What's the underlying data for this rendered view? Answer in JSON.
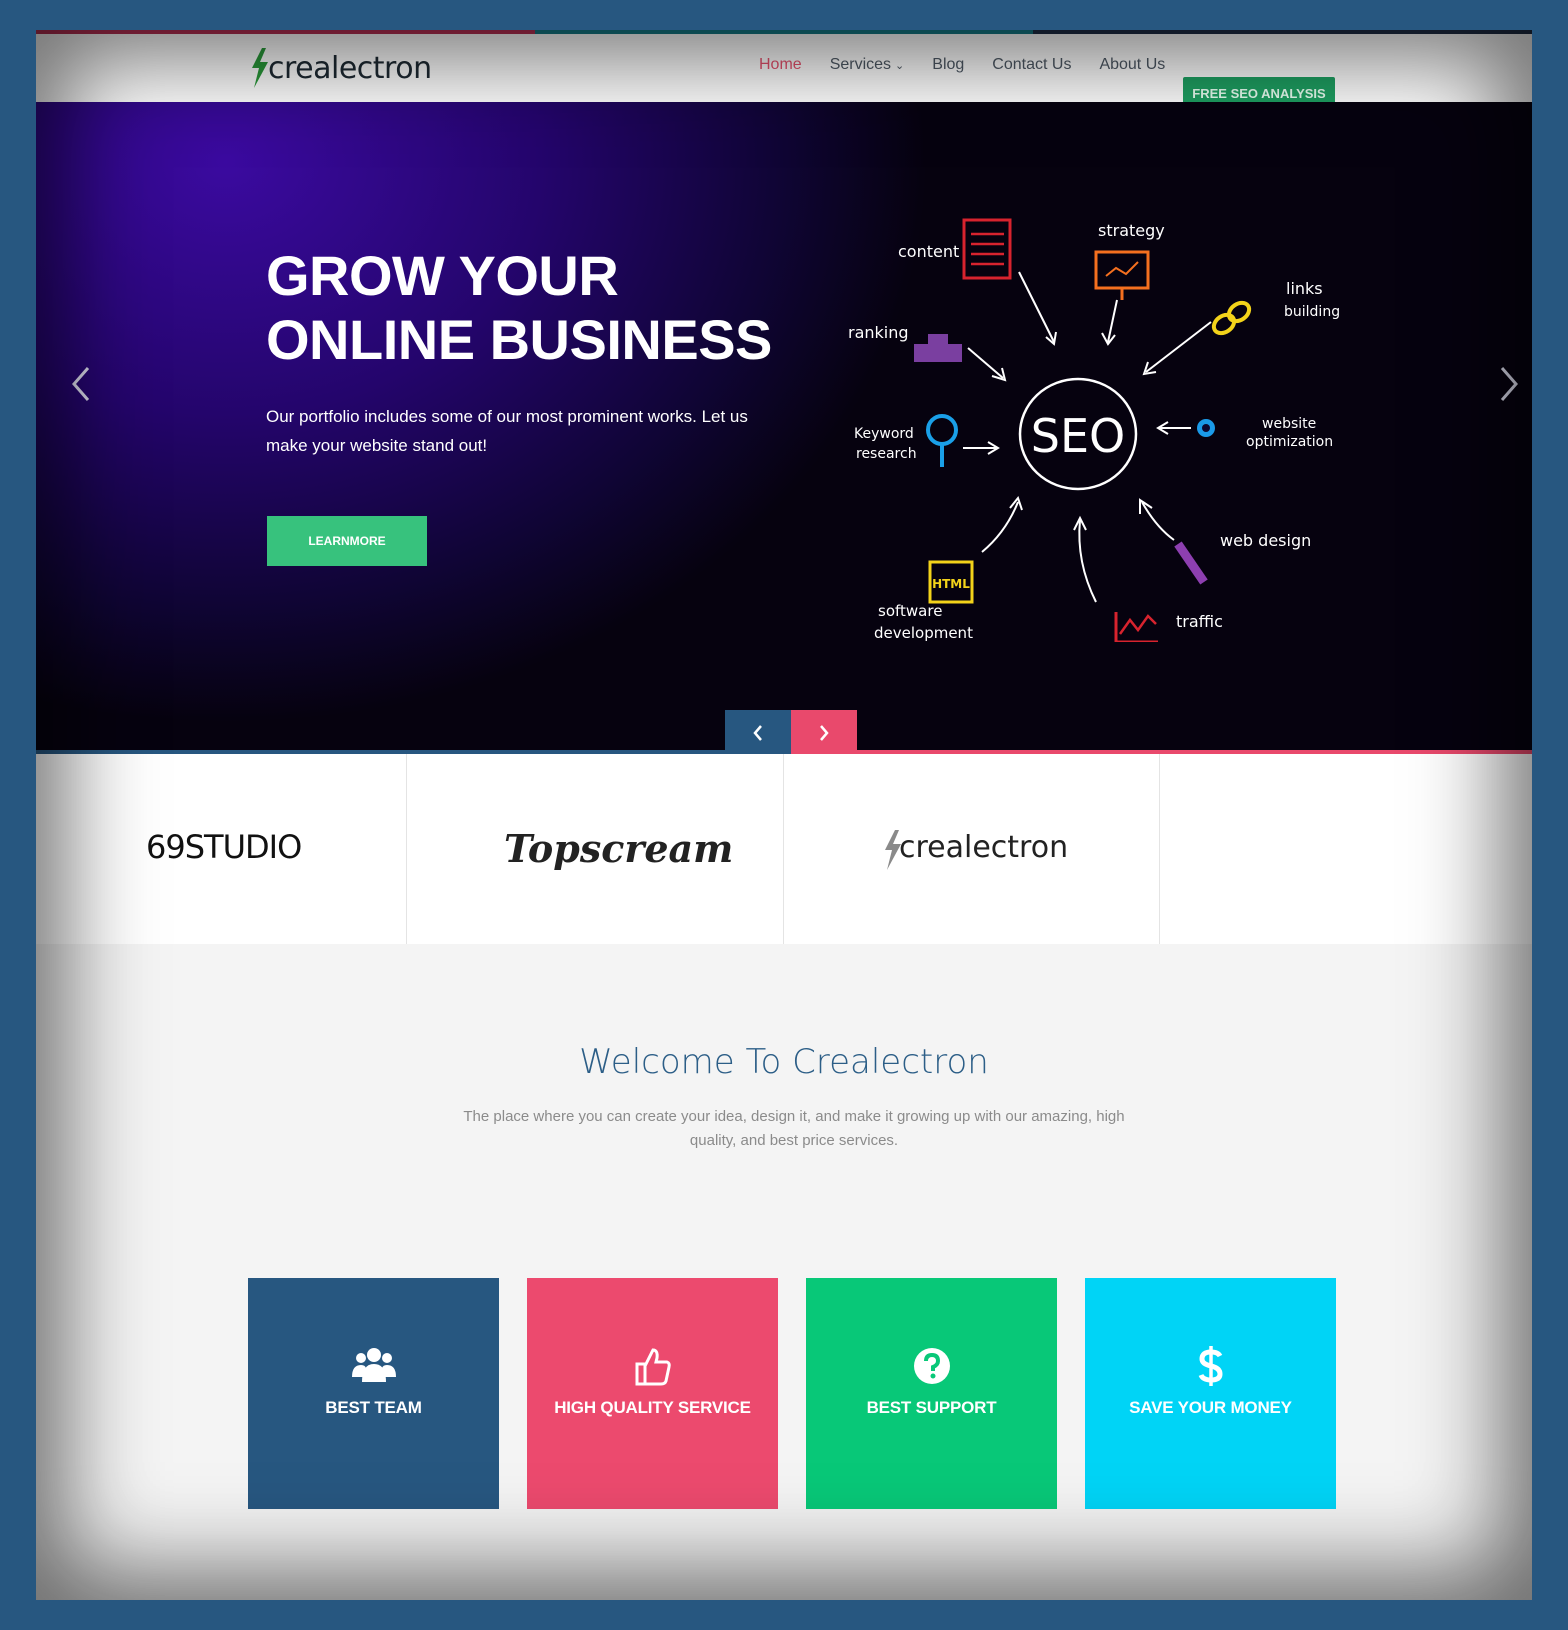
{
  "brand": {
    "name": "crealectron",
    "bolt_color": "#2a9a3a"
  },
  "top_strip_colors": [
    "#b63054",
    "#147a86",
    "#1f2d45"
  ],
  "nav": {
    "items": [
      {
        "label": "Home",
        "active": true
      },
      {
        "label": "Services",
        "active": false,
        "has_dropdown": true,
        "icon": "chevron-down-icon"
      },
      {
        "label": "Blog",
        "active": false
      },
      {
        "label": "Contact Us",
        "active": false
      },
      {
        "label": "About Us",
        "active": false
      }
    ],
    "cta_label": "FREE SEO ANALYSIS"
  },
  "hero": {
    "title": "GROW YOUR\nONLINE BUSINESS",
    "text": "Our portfolio includes some of our most prominent works. Let us make your website stand out!",
    "button_label": "LEARNMORE",
    "prev_icon": "chevron-left-icon",
    "next_icon": "chevron-right-icon",
    "illustration": {
      "center": "SEO",
      "labels": {
        "content": "content",
        "strategy": "strategy",
        "links_1": "links",
        "links_2": "building",
        "ranking": "ranking",
        "keyword_1": "Keyword",
        "keyword_2": "research",
        "website_1": "website",
        "website_2": "optimization",
        "html": "HTML",
        "software_1": "software",
        "software_2": "development",
        "traffic": "traffic",
        "web_design": "web design"
      }
    }
  },
  "pager": {
    "prev_color": "#275780",
    "next_color": "#e9496c"
  },
  "clients": [
    {
      "name": "69STUDIO"
    },
    {
      "name": "Topscream"
    },
    {
      "name": "crealectron"
    }
  ],
  "welcome": {
    "title": "Welcome To Crealectron",
    "text": "The place where you can create your idea, design it, and make it growing up with our amazing, high quality, and best price services."
  },
  "features": [
    {
      "label": "BEST TEAM",
      "icon": "users-icon",
      "color": "#275780"
    },
    {
      "label": "HIGH QUALITY SERVICE",
      "icon": "thumbs-up-icon",
      "color": "#ec4a6e"
    },
    {
      "label": "BEST SUPPORT",
      "icon": "question-circle-icon",
      "color": "#08c878"
    },
    {
      "label": "SAVE YOUR MONEY",
      "icon": "dollar-icon",
      "color": "#00d4f6"
    }
  ]
}
